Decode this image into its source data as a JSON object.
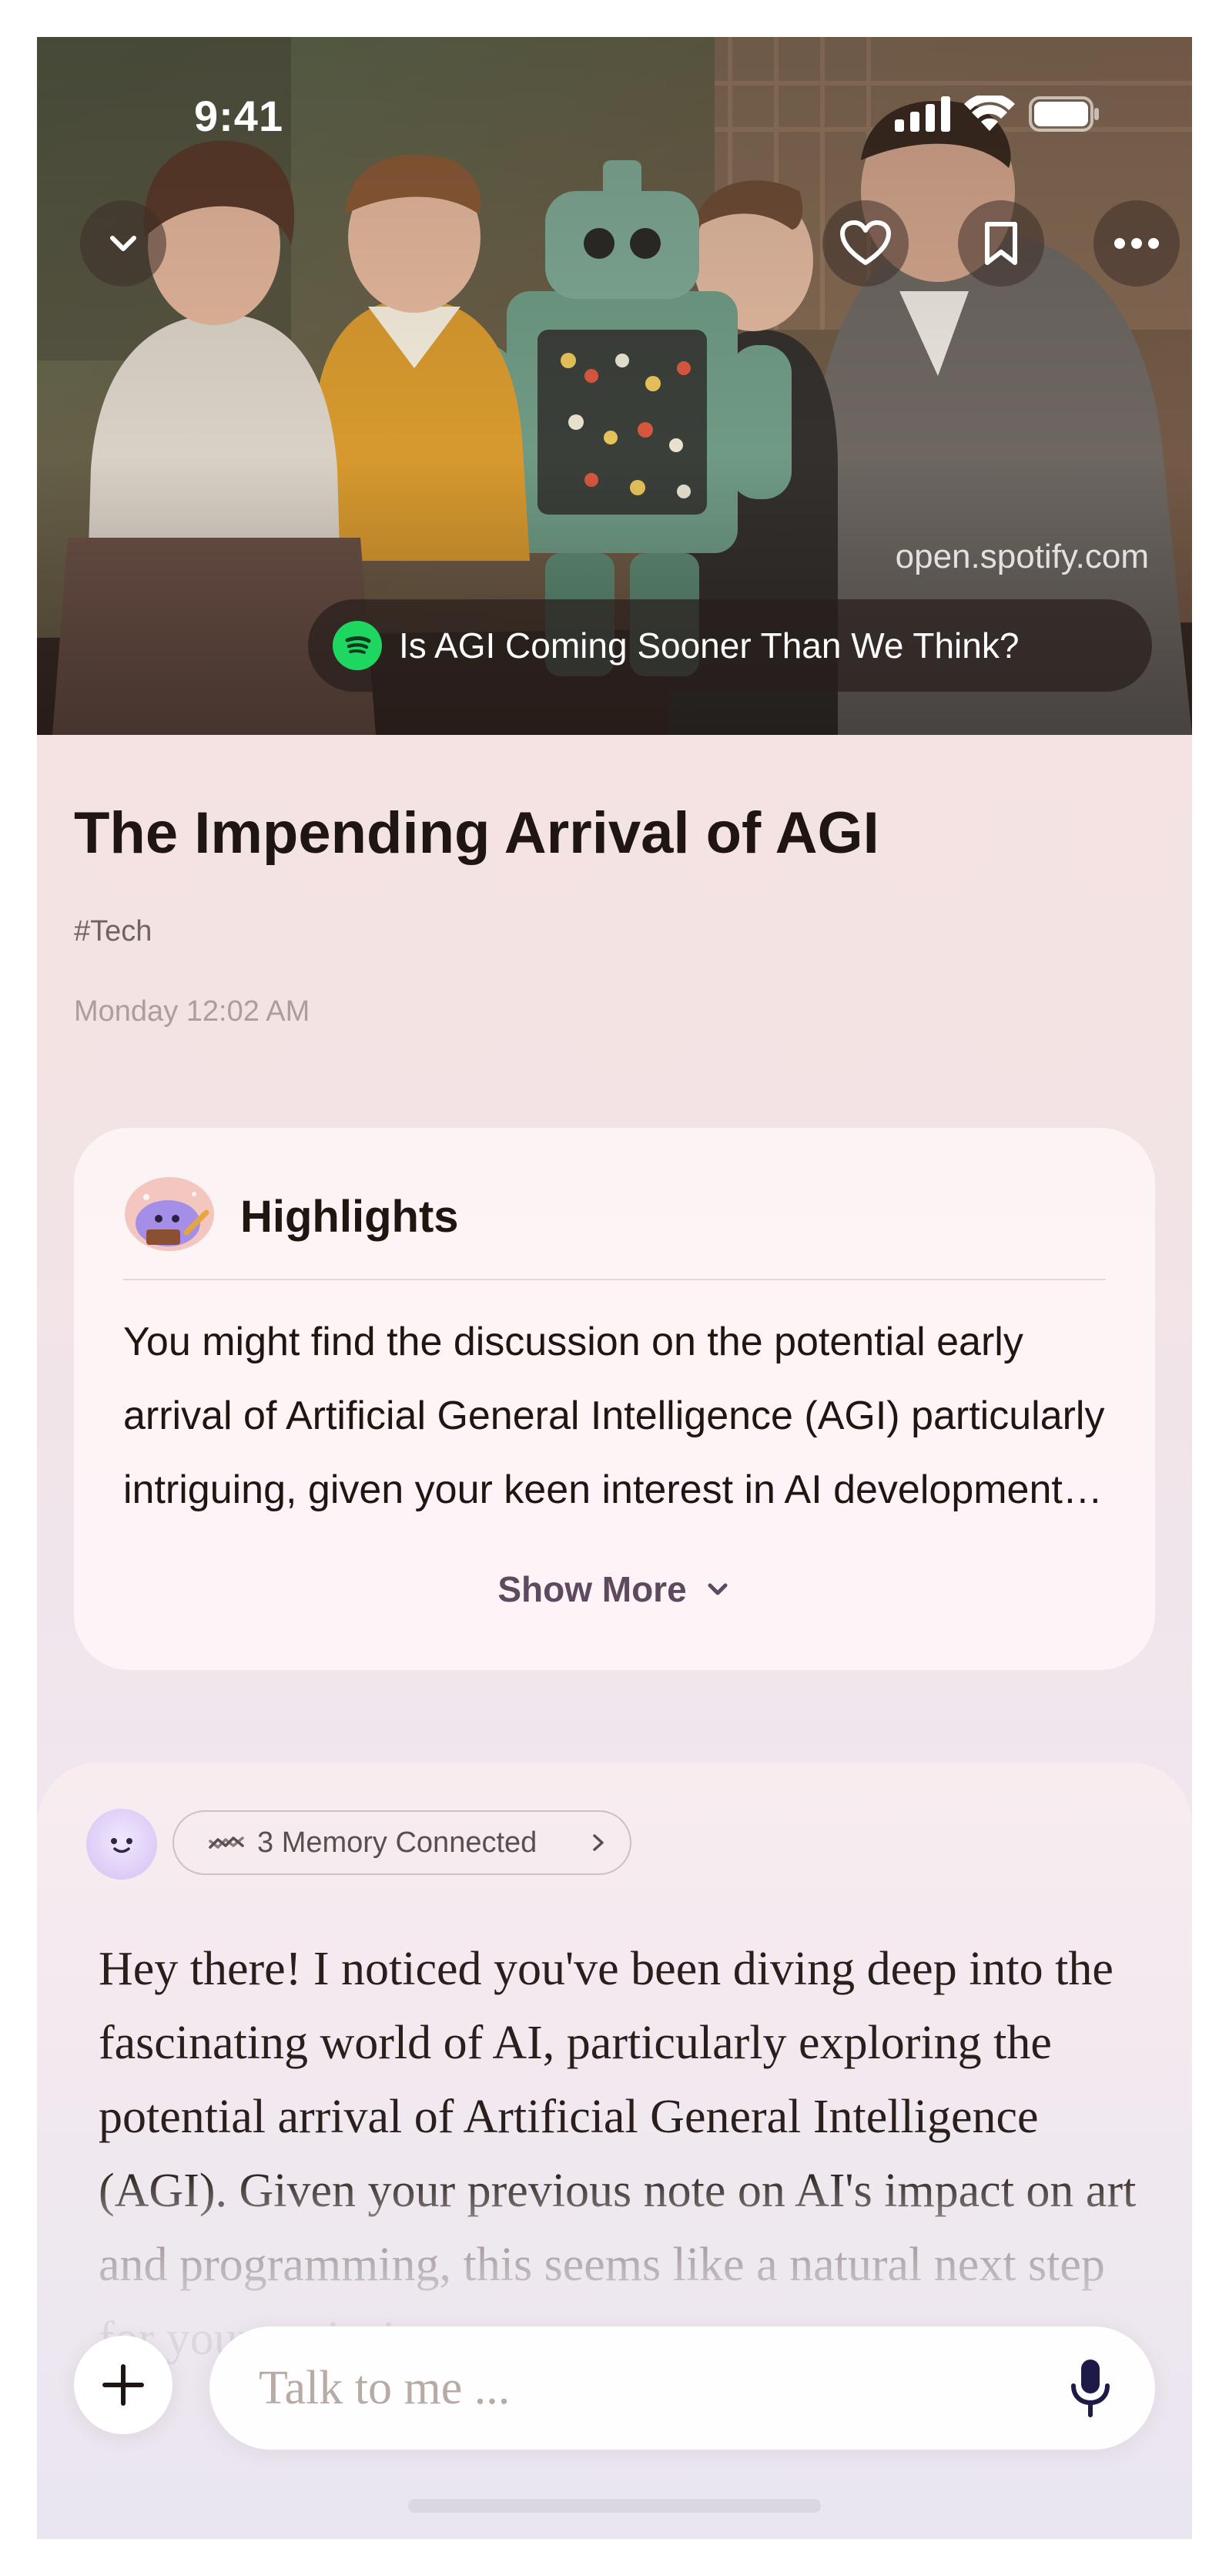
{
  "status_bar": {
    "time": "9:41"
  },
  "hero": {
    "source_url": "open.spotify.com",
    "source_title": "Is AGI Coming Sooner Than We Think?",
    "buttons": [
      "chevron-down-icon",
      "heart-icon",
      "bookmark-icon",
      "more-icon"
    ]
  },
  "article": {
    "title": "The Impending Arrival of AGI",
    "tag": "#Tech",
    "date": "Monday 12:02 AM"
  },
  "highlights": {
    "title": "Highlights",
    "body": "You might find the discussion on the potential early arrival of Artificial General Intelligence (AGI) particularly intriguing, given your keen interest in AI developments and their implications.",
    "show_more": "Show More"
  },
  "chat": {
    "memory_label": "3 Memory Connected",
    "message": "Hey there! I noticed you've been diving deep into the fascinating world of AI, particularly exploring the potential arrival of Artificial General Intelligence (AGI). Given your previous note on AI's impact on art and programming, this seems like a natural next step for your curiosity."
  },
  "composer": {
    "placeholder": "Talk to me ..."
  },
  "colors": {
    "accent": "#5e4a5e",
    "spotify": "#1ed760",
    "mic": "#1d1a48"
  }
}
